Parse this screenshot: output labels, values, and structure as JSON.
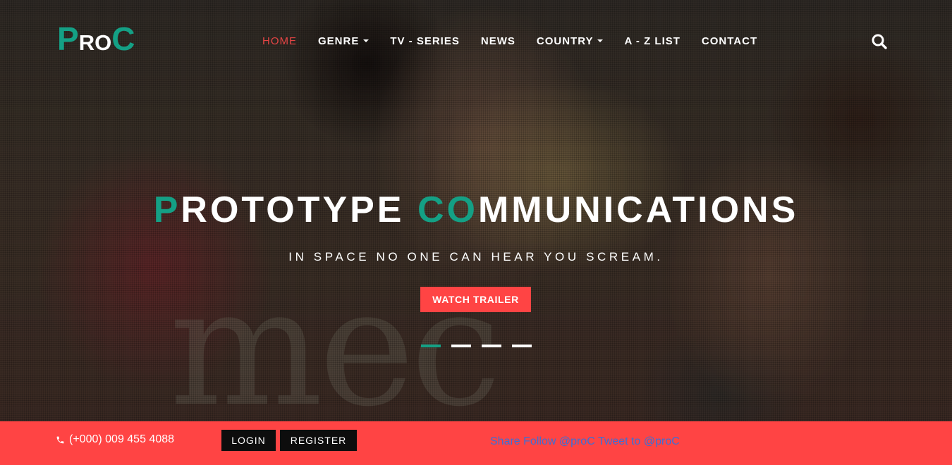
{
  "brand": {
    "logo_p": "P",
    "logo_ro": "RO",
    "logo_c": "C",
    "primary_color": "#14a085",
    "accent_color": "#ff4444"
  },
  "nav": {
    "items": [
      {
        "label": "HOME",
        "active": true
      },
      {
        "label": "GENRE",
        "dropdown": true
      },
      {
        "label": "TV - SERIES"
      },
      {
        "label": "NEWS"
      },
      {
        "label": "COUNTRY",
        "dropdown": true
      },
      {
        "label": "A - Z LIST"
      },
      {
        "label": "CONTACT"
      }
    ],
    "search_icon": "search-icon"
  },
  "hero": {
    "title_p": "P",
    "title_rototype": "ROTOTYPE ",
    "title_co": "CO",
    "title_mmunications": "MMUNICATIONS",
    "subtitle": "IN SPACE NO ONE CAN HEAR YOU SCREAM.",
    "button_label": "WATCH TRAILER",
    "background_text": "mec",
    "slides_total": 4,
    "active_slide": 1
  },
  "bottom_bar": {
    "phone_icon": "phone-icon",
    "phone": "(+000) 009 455 4088",
    "login_label": "LOGIN",
    "register_label": "REGISTER",
    "social_share": "Share",
    "social_follow": "Follow @proC",
    "social_tweet": "Tweet to @proC"
  }
}
